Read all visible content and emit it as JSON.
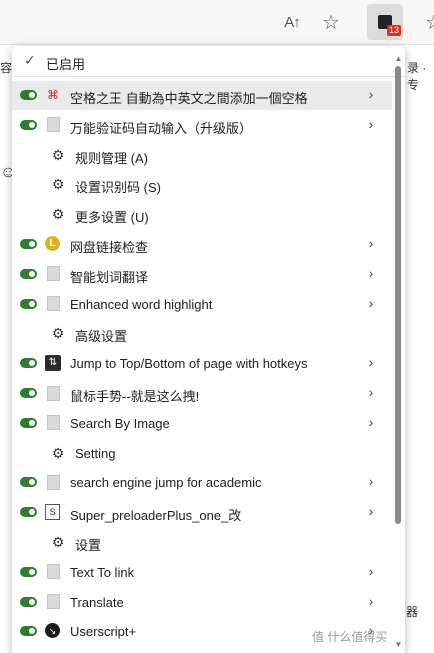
{
  "page": {
    "fragments": [
      "容",
      "录 · 专",
      "器"
    ],
    "watermark": "值 什么值得买"
  },
  "toolbar": {
    "read_aloud_icon": "A↑",
    "favorite_icon": "☆",
    "extension_badge": "13",
    "collections_icon": "☆"
  },
  "menu": {
    "header": {
      "check": "✓",
      "label": "已启用"
    },
    "items": [
      {
        "label": "空格之王 自動為中英文之間添加一個空格",
        "icon": "space-icon",
        "enabled": true,
        "submenu": true
      },
      {
        "label": "万能验证码自动输入（升级版）",
        "icon": "page-icon",
        "enabled": true,
        "submenu": true
      },
      {
        "label": "规则管理 (A)",
        "icon": "gear-icon",
        "sub": true
      },
      {
        "label": "设置识别码 (S)",
        "icon": "gear-icon",
        "sub": true
      },
      {
        "label": "更多设置 (U)",
        "icon": "gear-icon",
        "sub": true
      },
      {
        "label": "网盘链接检查",
        "icon": "gold-circle-icon",
        "enabled": true,
        "submenu": true
      },
      {
        "label": "智能划词翻译",
        "icon": "page-icon",
        "enabled": true,
        "submenu": true
      },
      {
        "label": "Enhanced word highlight",
        "icon": "page-icon",
        "enabled": true,
        "submenu": true
      },
      {
        "label": "高级设置",
        "icon": "gear-icon",
        "sub": true
      },
      {
        "label": "Jump to Top/Bottom of page with hotkeys",
        "icon": "updown-icon",
        "enabled": true,
        "submenu": true
      },
      {
        "label": "鼠标手势--就是这么拽!",
        "icon": "page-icon",
        "enabled": true,
        "submenu": true
      },
      {
        "label": "Search By Image",
        "icon": "page-icon",
        "enabled": true,
        "submenu": true
      },
      {
        "label": "Setting",
        "icon": "gear-icon",
        "sub": true
      },
      {
        "label": "search engine jump for academic",
        "icon": "page-icon",
        "enabled": true,
        "submenu": true
      },
      {
        "label": "Super_preloaderPlus_one_改",
        "icon": "book-icon",
        "enabled": true,
        "submenu": true
      },
      {
        "label": "设置",
        "icon": "gear-icon",
        "sub": true
      },
      {
        "label": "Text To link",
        "icon": "page-icon",
        "enabled": true,
        "submenu": true
      },
      {
        "label": "Translate",
        "icon": "page-icon",
        "enabled": true,
        "submenu": true
      },
      {
        "label": "Userscript+",
        "icon": "userscript-icon",
        "enabled": true,
        "submenu": true
      }
    ]
  }
}
